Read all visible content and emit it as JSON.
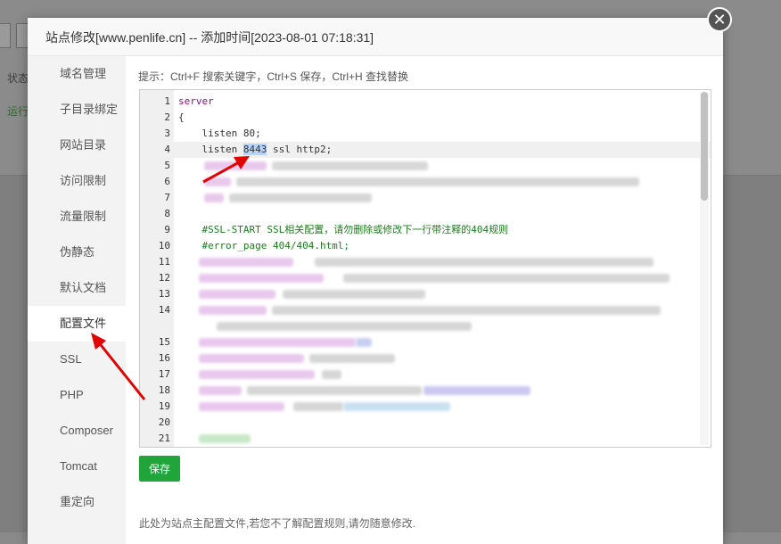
{
  "background": {
    "status_label": "状态",
    "running_label": "运行"
  },
  "modal": {
    "title": "站点修改[www.penlife.cn] -- 添加时间[2023-08-01 07:18:31]",
    "close_symbol": "✕"
  },
  "sidebar": {
    "items": [
      {
        "label": "域名管理"
      },
      {
        "label": "子目录绑定"
      },
      {
        "label": "网站目录"
      },
      {
        "label": "访问限制"
      },
      {
        "label": "流量限制"
      },
      {
        "label": "伪静态"
      },
      {
        "label": "默认文档"
      },
      {
        "label": "配置文件"
      },
      {
        "label": "SSL"
      },
      {
        "label": "PHP"
      },
      {
        "label": "Composer"
      },
      {
        "label": "Tomcat"
      },
      {
        "label": "重定向"
      }
    ],
    "active_index": 7
  },
  "editor": {
    "tip": "提示：Ctrl+F 搜索关键字，Ctrl+S 保存，Ctrl+H 查找替换",
    "line_numbers": [
      "1",
      "2",
      "3",
      "4",
      "5",
      "6",
      "7",
      "8",
      "9",
      "10",
      "11",
      "12",
      "13",
      "14",
      "",
      "15",
      "16",
      "17",
      "18",
      "19",
      "20",
      "21"
    ],
    "lines": {
      "l1": "server",
      "l2": "{",
      "l3": "    listen 80;",
      "l4_pre": "    listen ",
      "l4_sel": "8443",
      "l4_post": " ssl http2;",
      "l9": "    #SSL-START SSL相关配置，请勿删除或修改下一行带注释的404规则",
      "l10": "    #error_page 404/404.html;"
    },
    "highlighted_line": 4
  },
  "actions": {
    "save_label": "保存"
  },
  "footer": {
    "note": "此处为站点主配置文件,若您不了解配置规则,请勿随意修改."
  },
  "colors": {
    "accent_green": "#20a53a",
    "keyword": "#881280",
    "comment": "#1f7a1f",
    "annotation_arrow": "#e00000"
  }
}
